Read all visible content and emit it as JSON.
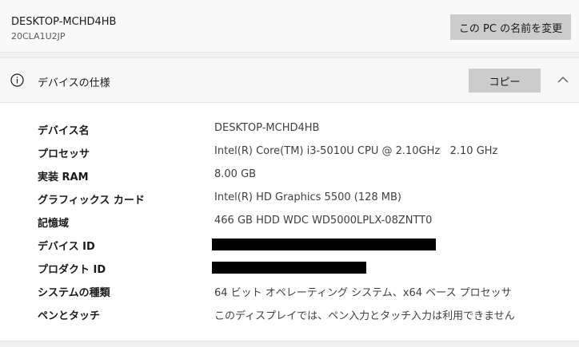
{
  "header": {
    "device_name": "DESKTOP-MCHD4HB",
    "device_model": "20CLA1U2JP",
    "rename_label": "この PC の名前を変更"
  },
  "specs": {
    "title": "デバイスの仕様",
    "copy_label": "コピー",
    "icons": {
      "info": "info-icon",
      "collapse": "chevron-up-icon"
    },
    "rows": [
      {
        "label": "デバイス名",
        "value": "DESKTOP-MCHD4HB"
      },
      {
        "label": "プロセッサ",
        "value": "Intel(R) Core(TM) i3-5010U CPU @ 2.10GHz   2.10 GHz"
      },
      {
        "label": "実装 RAM",
        "value": "8.00 GB"
      },
      {
        "label": "グラフィックス カード",
        "value": "Intel(R) HD Graphics 5500 (128 MB)"
      },
      {
        "label": "記憶域",
        "value": "466 GB HDD WDC WD5000LPLX-08ZNTT0"
      },
      {
        "label": "デバイス ID",
        "value": null,
        "redacted": true
      },
      {
        "label": "プロダクト ID",
        "value": null,
        "redacted": true
      },
      {
        "label": "システムの種類",
        "value": "64 ビット オペレーティング システム、x64 ベース プロセッサ"
      },
      {
        "label": "ペンとタッチ",
        "value": "このディスプレイでは、ペン入力とタッチ入力は利用できません"
      }
    ]
  },
  "colors": {
    "window_bg": "#f0f0f0",
    "panel_bg": "#ffffff",
    "button_bg": "#cccccc",
    "text": "#1a1a1a",
    "value_text": "#404040",
    "redaction": "#000000"
  }
}
